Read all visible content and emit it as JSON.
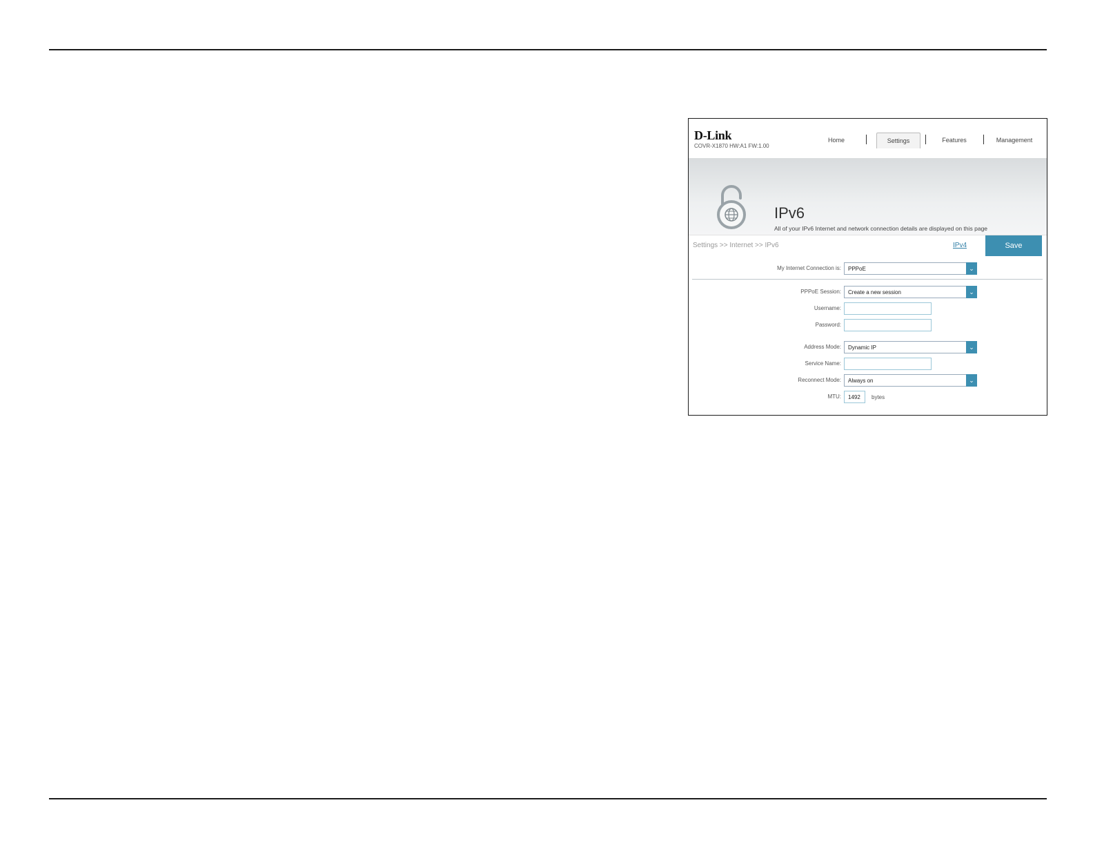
{
  "app": {
    "brand": "D-Link",
    "model": "COVR-X1870 HW:A1 FW:1.00"
  },
  "nav": {
    "home": "Home",
    "settings": "Settings",
    "features": "Features",
    "management": "Management"
  },
  "banner": {
    "title": "IPv6",
    "description": "All of your IPv6 Internet and network connection details are displayed on this page",
    "icon": "lock-globe-icon"
  },
  "breadcrumb": "Settings >> Internet >> IPv6",
  "actions": {
    "ipv4_link": "IPv4",
    "save": "Save"
  },
  "form": {
    "connection": {
      "label": "My Internet Connection is:",
      "value": "PPPoE"
    },
    "session": {
      "label": "PPPoE Session:",
      "value": "Create a new session"
    },
    "username": {
      "label": "Username:",
      "value": ""
    },
    "password": {
      "label": "Password:",
      "value": ""
    },
    "address_mode": {
      "label": "Address Mode:",
      "value": "Dynamic IP"
    },
    "service_name": {
      "label": "Service Name:",
      "value": ""
    },
    "reconnect_mode": {
      "label": "Reconnect Mode:",
      "value": "Always on"
    },
    "mtu": {
      "label": "MTU:",
      "value": "1492",
      "unit": "bytes"
    }
  },
  "colors": {
    "accent": "#3d8fb1",
    "link": "#2f7ea6"
  }
}
